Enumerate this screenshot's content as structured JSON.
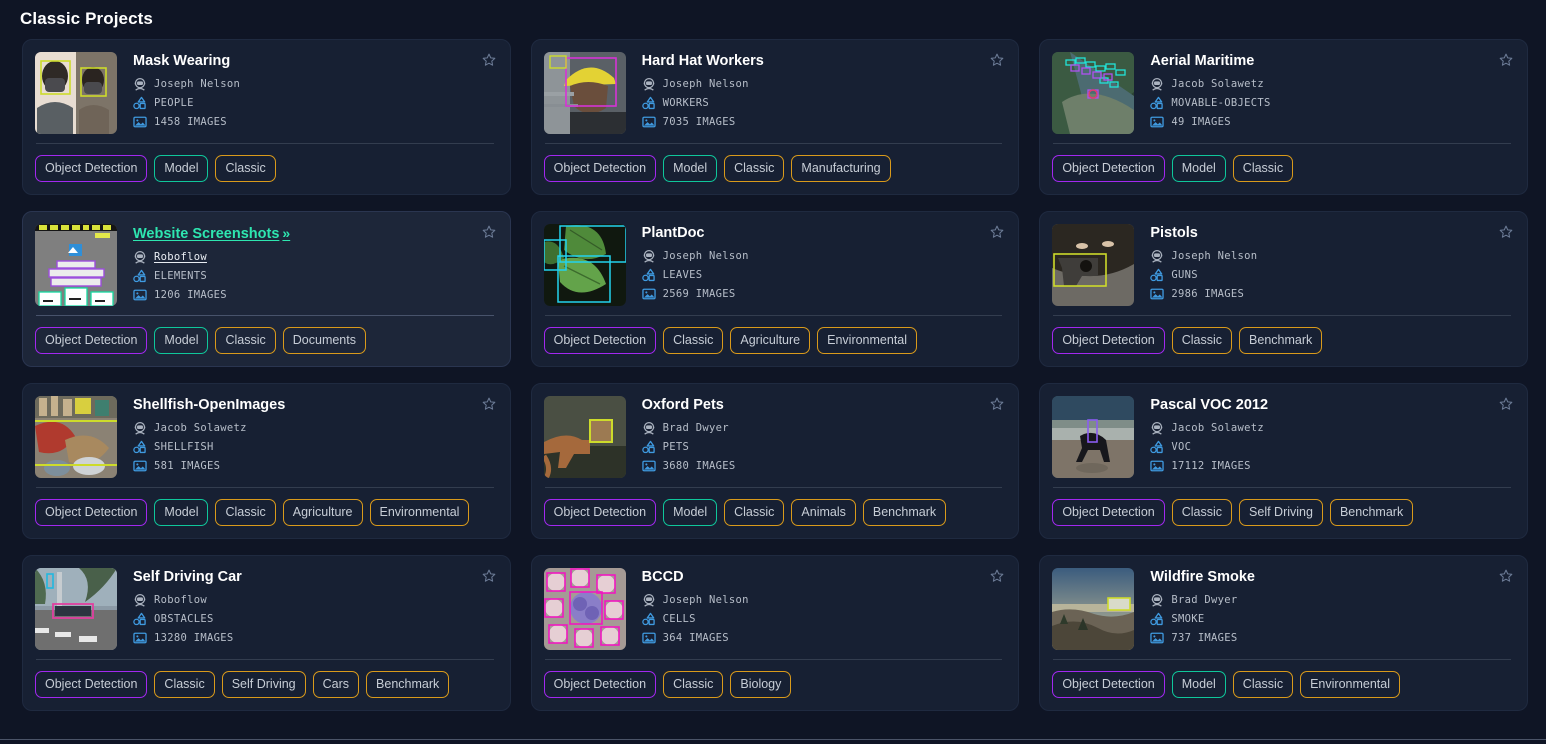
{
  "page": {
    "title": "Classic Projects",
    "background_color": "#0f1525",
    "card_background_color": "#172033",
    "card_hover_background_color": "#1d2639",
    "accent_color": "#2ee6b0",
    "tag_colors": {
      "purple": "#a228f0",
      "teal": "#0fc79b",
      "amber": "#d99a1b"
    }
  },
  "icons": {
    "author": "astronaut-user-icon",
    "classes": "shapes-objects-icon",
    "images": "image-icon",
    "star": "star-outline-icon",
    "chevron": "»"
  },
  "projects": [
    {
      "title": "Mask Wearing",
      "author": "Joseph Nelson",
      "classes": "PEOPLE",
      "images": "1458 IMAGES",
      "hovered": false,
      "thumb": "mask-wearing-thumbnail",
      "tags": [
        {
          "label": "Object Detection",
          "color": "purple"
        },
        {
          "label": "Model",
          "color": "teal"
        },
        {
          "label": "Classic",
          "color": "amber"
        }
      ]
    },
    {
      "title": "Hard Hat Workers",
      "author": "Joseph Nelson",
      "classes": "WORKERS",
      "images": "7035 IMAGES",
      "hovered": false,
      "thumb": "hard-hat-workers-thumbnail",
      "tags": [
        {
          "label": "Object Detection",
          "color": "purple"
        },
        {
          "label": "Model",
          "color": "teal"
        },
        {
          "label": "Classic",
          "color": "amber"
        },
        {
          "label": "Manufacturing",
          "color": "amber"
        }
      ]
    },
    {
      "title": "Aerial Maritime",
      "author": "Jacob Solawetz",
      "classes": "MOVABLE-OBJECTS",
      "images": "49 IMAGES",
      "hovered": false,
      "thumb": "aerial-maritime-thumbnail",
      "tags": [
        {
          "label": "Object Detection",
          "color": "purple"
        },
        {
          "label": "Model",
          "color": "teal"
        },
        {
          "label": "Classic",
          "color": "amber"
        }
      ]
    },
    {
      "title": "Website Screenshots",
      "author": "Roboflow",
      "classes": "ELEMENTS",
      "images": "1206 IMAGES",
      "hovered": true,
      "thumb": "website-screenshots-thumbnail",
      "tags": [
        {
          "label": "Object Detection",
          "color": "purple"
        },
        {
          "label": "Model",
          "color": "teal"
        },
        {
          "label": "Classic",
          "color": "amber"
        },
        {
          "label": "Documents",
          "color": "amber"
        }
      ]
    },
    {
      "title": "PlantDoc",
      "author": "Joseph Nelson",
      "classes": "LEAVES",
      "images": "2569 IMAGES",
      "hovered": false,
      "thumb": "plantdoc-thumbnail",
      "tags": [
        {
          "label": "Object Detection",
          "color": "purple"
        },
        {
          "label": "Classic",
          "color": "amber"
        },
        {
          "label": "Agriculture",
          "color": "amber"
        },
        {
          "label": "Environmental",
          "color": "amber"
        }
      ]
    },
    {
      "title": "Pistols",
      "author": "Joseph Nelson",
      "classes": "GUNS",
      "images": "2986 IMAGES",
      "hovered": false,
      "thumb": "pistols-thumbnail",
      "tags": [
        {
          "label": "Object Detection",
          "color": "purple"
        },
        {
          "label": "Classic",
          "color": "amber"
        },
        {
          "label": "Benchmark",
          "color": "amber"
        }
      ]
    },
    {
      "title": "Shellfish-OpenImages",
      "author": "Jacob Solawetz",
      "classes": "SHELLFISH",
      "images": "581 IMAGES",
      "hovered": false,
      "thumb": "shellfish-openimages-thumbnail",
      "tags": [
        {
          "label": "Object Detection",
          "color": "purple"
        },
        {
          "label": "Model",
          "color": "teal"
        },
        {
          "label": "Classic",
          "color": "amber"
        },
        {
          "label": "Agriculture",
          "color": "amber"
        },
        {
          "label": "Environmental",
          "color": "amber"
        }
      ]
    },
    {
      "title": "Oxford Pets",
      "author": "Brad Dwyer",
      "classes": "PETS",
      "images": "3680 IMAGES",
      "hovered": false,
      "thumb": "oxford-pets-thumbnail",
      "tags": [
        {
          "label": "Object Detection",
          "color": "purple"
        },
        {
          "label": "Model",
          "color": "teal"
        },
        {
          "label": "Classic",
          "color": "amber"
        },
        {
          "label": "Animals",
          "color": "amber"
        },
        {
          "label": "Benchmark",
          "color": "amber"
        }
      ]
    },
    {
      "title": "Pascal VOC 2012",
      "author": "Jacob Solawetz",
      "classes": "VOC",
      "images": "17112 IMAGES",
      "hovered": false,
      "thumb": "pascal-voc-2012-thumbnail",
      "tags": [
        {
          "label": "Object Detection",
          "color": "purple"
        },
        {
          "label": "Classic",
          "color": "amber"
        },
        {
          "label": "Self Driving",
          "color": "amber"
        },
        {
          "label": "Benchmark",
          "color": "amber"
        }
      ]
    },
    {
      "title": "Self Driving Car",
      "author": "Roboflow",
      "classes": "OBSTACLES",
      "images": "13280 IMAGES",
      "hovered": false,
      "thumb": "self-driving-car-thumbnail",
      "tags": [
        {
          "label": "Object Detection",
          "color": "purple"
        },
        {
          "label": "Classic",
          "color": "amber"
        },
        {
          "label": "Self Driving",
          "color": "amber"
        },
        {
          "label": "Cars",
          "color": "amber"
        },
        {
          "label": "Benchmark",
          "color": "amber"
        }
      ]
    },
    {
      "title": "BCCD",
      "author": "Joseph Nelson",
      "classes": "CELLS",
      "images": "364 IMAGES",
      "hovered": false,
      "thumb": "bccd-thumbnail",
      "tags": [
        {
          "label": "Object Detection",
          "color": "purple"
        },
        {
          "label": "Classic",
          "color": "amber"
        },
        {
          "label": "Biology",
          "color": "amber"
        }
      ]
    },
    {
      "title": "Wildfire Smoke",
      "author": "Brad Dwyer",
      "classes": "SMOKE",
      "images": "737 IMAGES",
      "hovered": false,
      "thumb": "wildfire-smoke-thumbnail",
      "tags": [
        {
          "label": "Object Detection",
          "color": "purple"
        },
        {
          "label": "Model",
          "color": "teal"
        },
        {
          "label": "Classic",
          "color": "amber"
        },
        {
          "label": "Environmental",
          "color": "amber"
        }
      ]
    }
  ]
}
